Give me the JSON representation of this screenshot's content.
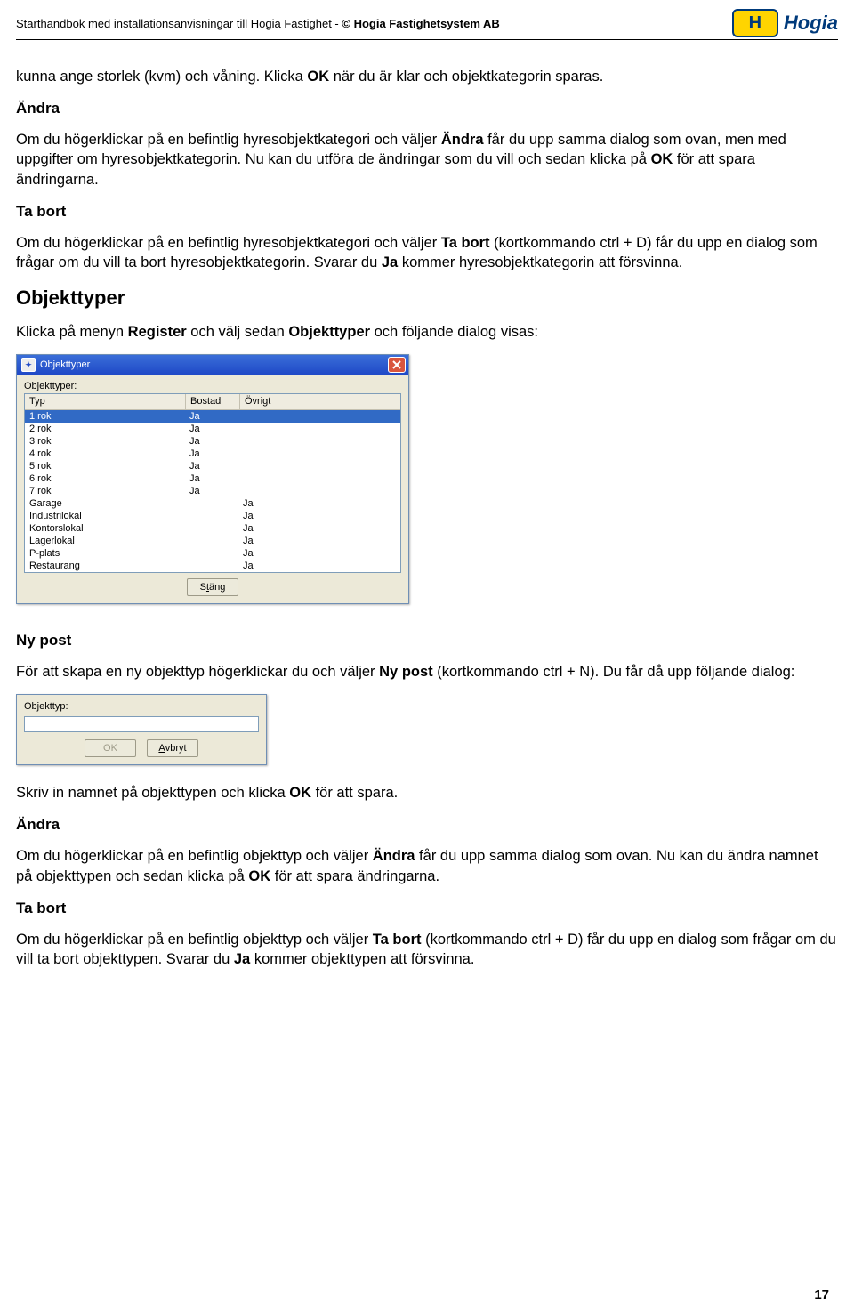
{
  "header": {
    "title_1": "Starthandbok med installationsanvisningar till Hogia Fastighet - ",
    "title_2": "© Hogia Fastighetsystem AB",
    "logo_letter": "H",
    "logo_text": "Hogia"
  },
  "p1_a": "kunna ange storlek (kvm) och våning. Klicka ",
  "p1_b": "OK",
  "p1_c": " när du är klar och objektkategorin sparas.",
  "h_andra1": "Ändra",
  "p2_a": "Om du högerklickar på en befintlig hyresobjektkategori och väljer ",
  "p2_b": "Ändra",
  "p2_c": " får du upp samma dialog som ovan, men med uppgifter om hyresobjektkategorin. Nu kan du utföra de ändringar som du vill och sedan klicka på ",
  "p2_d": "OK",
  "p2_e": " för att spara ändringarna.",
  "h_tabort1": "Ta bort",
  "p3_a": "Om du högerklickar på en befintlig hyresobjektkategori och väljer ",
  "p3_b": "Ta bort",
  "p3_c": " (kortkommando ctrl + D) får du upp en dialog som frågar om du vill ta bort hyresobjektkategorin. Svarar du ",
  "p3_d": "Ja",
  "p3_e": " kommer hyresobjektkategorin att försvinna.",
  "h_objtyper": "Objekttyper",
  "p4_a": "Klicka på menyn ",
  "p4_b": "Register",
  "p4_c": " och välj sedan ",
  "p4_d": "Objekttyper",
  "p4_e": " och följande dialog visas:",
  "dlg1": {
    "title": "Objekttyper",
    "label": "Objekttyper:",
    "col_typ": "Typ",
    "col_bostad": "Bostad",
    "col_ovrigt": "Övrigt",
    "rows": [
      {
        "typ": "1 rok",
        "b": "Ja",
        "o": ""
      },
      {
        "typ": "2 rok",
        "b": "Ja",
        "o": ""
      },
      {
        "typ": "3 rok",
        "b": "Ja",
        "o": ""
      },
      {
        "typ": "4 rok",
        "b": "Ja",
        "o": ""
      },
      {
        "typ": "5 rok",
        "b": "Ja",
        "o": ""
      },
      {
        "typ": "6 rok",
        "b": "Ja",
        "o": ""
      },
      {
        "typ": "7 rok",
        "b": "Ja",
        "o": ""
      },
      {
        "typ": "Garage",
        "b": "",
        "o": "Ja"
      },
      {
        "typ": "Industrilokal",
        "b": "",
        "o": "Ja"
      },
      {
        "typ": "Kontorslokal",
        "b": "",
        "o": "Ja"
      },
      {
        "typ": "Lagerlokal",
        "b": "",
        "o": "Ja"
      },
      {
        "typ": "P-plats",
        "b": "",
        "o": "Ja"
      },
      {
        "typ": "Restaurang",
        "b": "",
        "o": "Ja"
      }
    ],
    "btn_stang_pre": "S",
    "btn_stang_u": "t",
    "btn_stang_post": "äng"
  },
  "h_nypost": "Ny post",
  "p5_a": "För att skapa en ny objekttyp högerklickar du och väljer ",
  "p5_b": "Ny post",
  "p5_c": " (kortkommando ctrl + N). Du får då upp följande dialog:",
  "dlg2": {
    "label": "Objekttyp:",
    "btn_ok": "OK",
    "btn_av_u": "A",
    "btn_av_rest": "vbryt"
  },
  "p6_a": "Skriv in namnet på objekttypen och klicka ",
  "p6_b": "OK",
  "p6_c": " för att spara.",
  "h_andra2": "Ändra",
  "p7_a": "Om du högerklickar på en befintlig objekttyp och väljer ",
  "p7_b": "Ändra",
  "p7_c": " får du upp samma dialog som ovan. Nu kan du ändra namnet på objekttypen och sedan klicka på ",
  "p7_d": "OK",
  "p7_e": " för att spara ändringarna.",
  "h_tabort2": "Ta bort",
  "p8_a": "Om du högerklickar på en befintlig objekttyp och väljer ",
  "p8_b": "Ta bort",
  "p8_c": " (kortkommando ctrl + D) får du upp en dialog som frågar om du vill ta bort objekttypen. Svarar du ",
  "p8_d": "Ja",
  "p8_e": " kommer objekttypen att försvinna.",
  "page_number": "17"
}
